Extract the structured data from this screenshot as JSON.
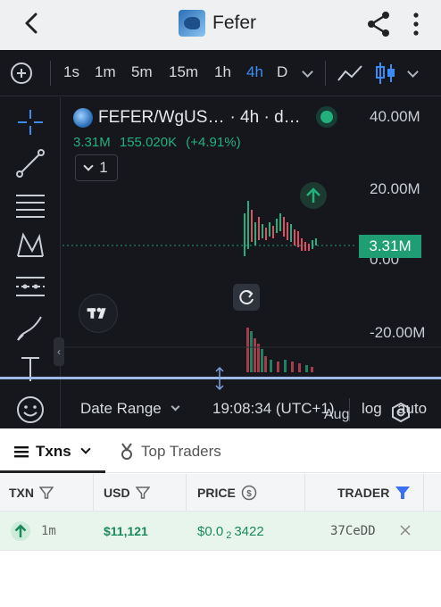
{
  "header": {
    "title": "Fefer"
  },
  "timeframes": {
    "items": [
      "1s",
      "1m",
      "5m",
      "15m",
      "1h",
      "4h",
      "D"
    ],
    "active": "4h"
  },
  "chart": {
    "symbol": "FEFER/WgUS…",
    "interval_label": "· 4h · d…",
    "volume": "3.31M",
    "value": "155.020K",
    "change": "(+4.91%)",
    "collapse_count": "1",
    "y_labels": [
      "40.00M",
      "20.00M",
      "0.00",
      "-20.00M"
    ],
    "last_price": "3.31M",
    "x_label": "Aug",
    "colors": {
      "up": "#22b07d",
      "down": "#e04f5f",
      "accent": "#3b8cf5"
    }
  },
  "chart_bar": {
    "date_range": "Date Range",
    "time": "19:08:34 (UTC+1)",
    "log": "log",
    "auto": "auto"
  },
  "tabs": {
    "txns": "Txns",
    "top_traders": "Top Traders"
  },
  "table": {
    "headers": {
      "txn": "TXN",
      "usd": "USD",
      "price": "PRICE",
      "trader": "TRADER"
    },
    "rows": [
      {
        "age": "1m",
        "usd": "$11,121",
        "price_prefix": "$0.0",
        "price_zeros": "2",
        "price_digits": "3422",
        "trader": "37CeDD"
      }
    ]
  }
}
